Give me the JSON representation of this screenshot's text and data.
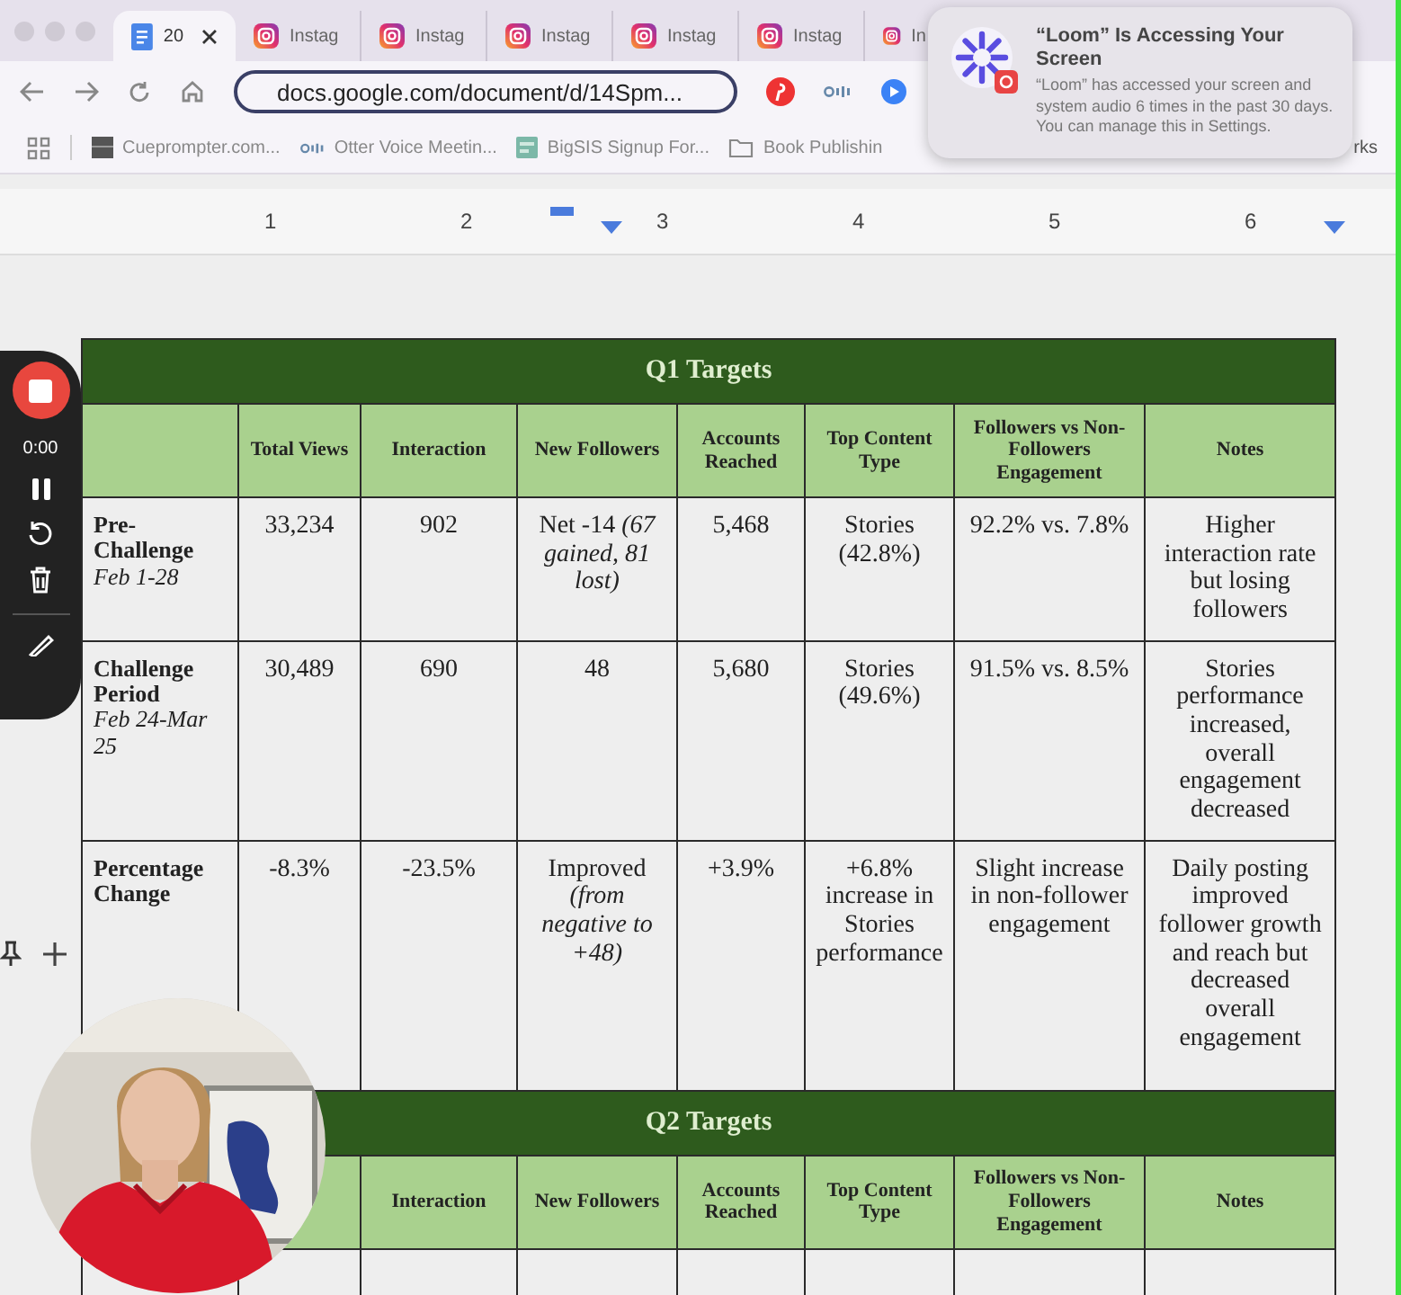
{
  "browser": {
    "tabs": [
      {
        "label": "20",
        "kind": "docs",
        "selected": true
      },
      {
        "label": "Instag",
        "kind": "instagram",
        "selected": false
      },
      {
        "label": "Instag",
        "kind": "instagram",
        "selected": false
      },
      {
        "label": "Instag",
        "kind": "instagram",
        "selected": false
      },
      {
        "label": "Instag",
        "kind": "instagram",
        "selected": false
      },
      {
        "label": "Instag",
        "kind": "instagram",
        "selected": false
      },
      {
        "label": "In",
        "kind": "instagram",
        "selected": false
      }
    ],
    "address": "docs.google.com/document/d/14Spm...",
    "bookmarks": [
      {
        "label": "Cueprompter.com...",
        "kind": "page"
      },
      {
        "label": "Otter Voice Meetin...",
        "kind": "otter"
      },
      {
        "label": "BigSIS Signup For...",
        "kind": "form"
      },
      {
        "label": "Book Publishin",
        "kind": "folder"
      }
    ],
    "bookmarks_end": "rks"
  },
  "notification": {
    "title": "“Loom” Is Accessing Your Screen",
    "body": "“Loom” has accessed your screen and system audio 6 times in the past 30 days. You can manage this in Settings."
  },
  "recorder": {
    "time": "0:00"
  },
  "ruler": {
    "marks": [
      "1",
      "2",
      "3",
      "4",
      "5",
      "6"
    ]
  },
  "tables": [
    {
      "title": "Q1 Targets",
      "columns": [
        "Total Views",
        "Interaction",
        "New Followers",
        "Accounts Reached",
        "Top Content Type",
        "Followers vs Non-Followers Engagement",
        "Notes"
      ],
      "rows": [
        {
          "label": "Pre-Challenge",
          "dates": "Feb 1-28",
          "cells": [
            "33,234",
            "902",
            "Net -14 *(67 gained, 81 lost)*",
            "5,468",
            "Stories (42.8%)",
            "92.2% vs. 7.8%",
            "Higher interaction rate but losing followers"
          ]
        },
        {
          "label": "Challenge Period",
          "dates": "Feb 24-Mar 25",
          "cells": [
            "30,489",
            "690",
            "48",
            "5,680",
            "Stories (49.6%)",
            "91.5% vs. 8.5%",
            "Stories performance increased, overall engagement decreased"
          ]
        },
        {
          "label": "Percentage Change",
          "cells": [
            "-8.3%",
            "-23.5%",
            "Improved *(from negative to +48)*",
            "+3.9%",
            "+6.8% increase in Stories performance",
            "Slight increase in non-follower engagement",
            "Daily posting improved follower growth and reach but decreased overall engagement"
          ]
        }
      ]
    },
    {
      "title": "Q2 Targets",
      "columns": [
        "Interaction",
        "New Followers",
        "Accounts Reached",
        "Top Content Type",
        "Followers vs Non-Followers Engagement",
        "Notes"
      ]
    }
  ]
}
